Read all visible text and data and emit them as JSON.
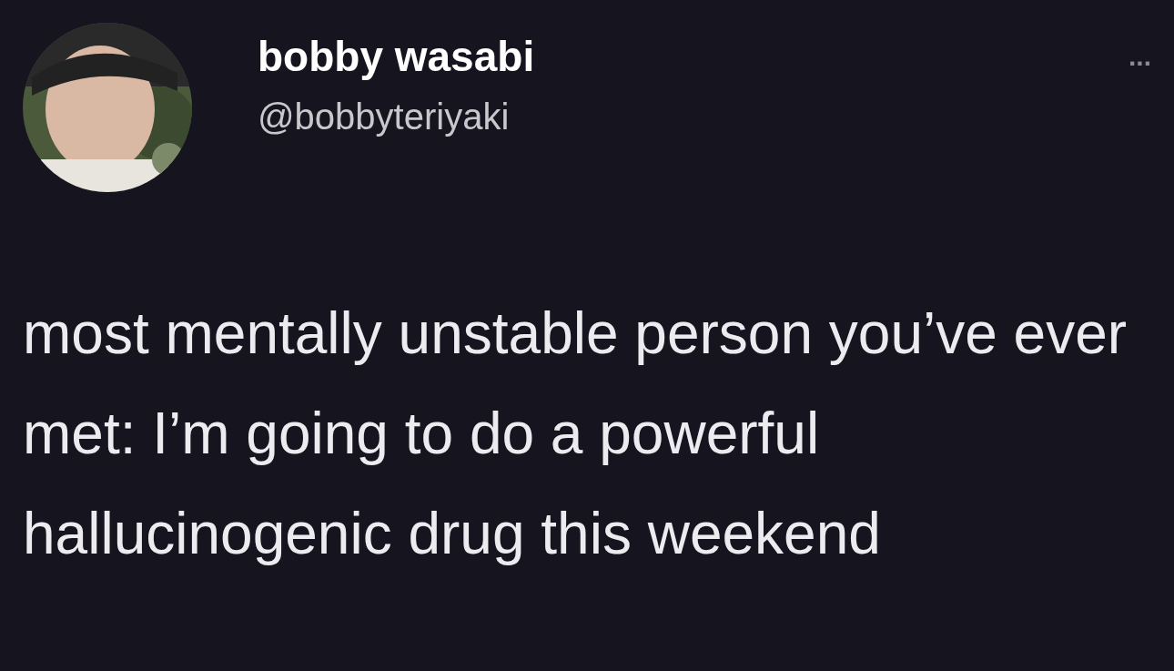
{
  "tweet": {
    "author": {
      "name": "bobby wasabi",
      "handle": "@bobbyteriyaki"
    },
    "more_menu": "...",
    "text": "most mentally unstable person you’ve ever met: I’m going to do a powerful hallucinogenic drug this weekend"
  }
}
